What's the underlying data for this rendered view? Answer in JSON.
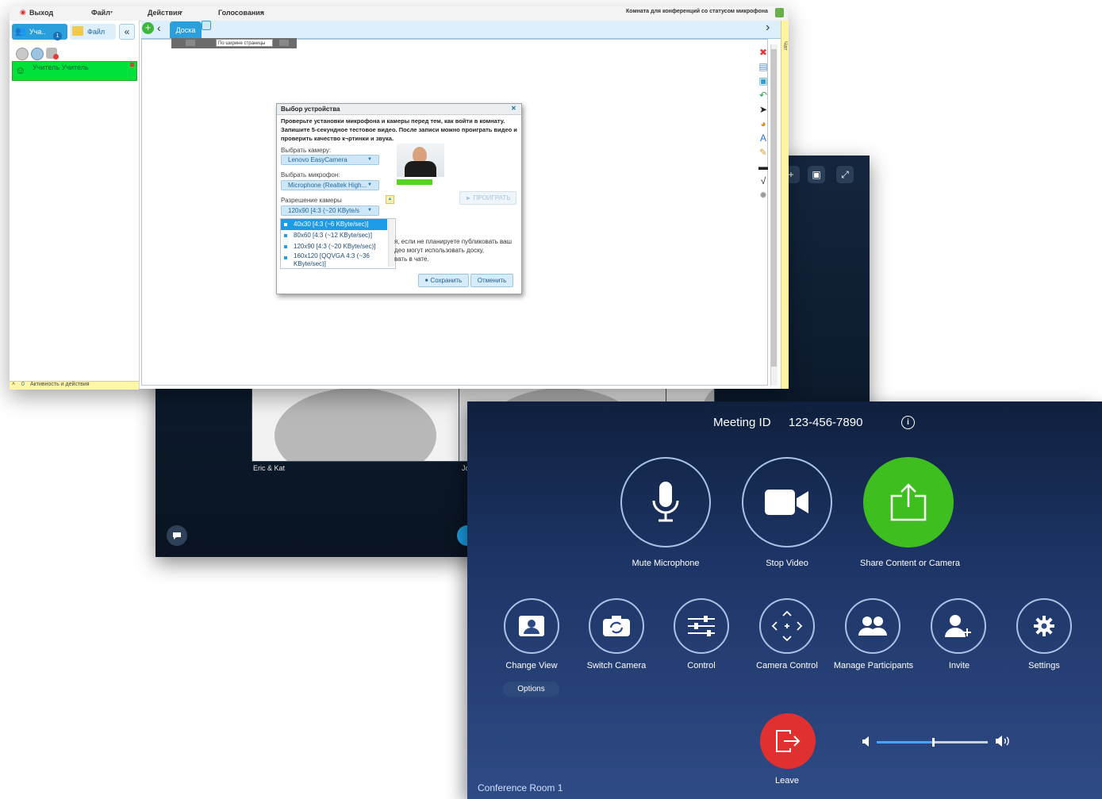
{
  "lms": {
    "menu": {
      "exit": "Выход",
      "file": "Файл",
      "actions": "Действия",
      "voting": "Голосования"
    },
    "room_status": "Комната для конференций со статусом микрофона",
    "left_tabs": {
      "participants": "Уча..",
      "files": "Файл",
      "participants_badge": "1"
    },
    "teacher_name": "Учитель Учитель",
    "footer": {
      "count": "0",
      "label": "Активность и действия"
    },
    "board_tab": "Доска",
    "zoom_select": "По ширине страницы",
    "side_tab": "Чат"
  },
  "dialog": {
    "title": "Выбор устройства",
    "intro": "Проверьте установки микрофона и камеры перед тем, как войти в комнату. Запишите 5-секундное тестовое видео. После записи можно проиграть видео и проверить качество к¬ртинки и звука.",
    "camera_label": "Выбрать камеру:",
    "camera_value": "Lenovo EasyCamera",
    "mic_label": "Выбрать микрофон:",
    "mic_value": "Microphone (Realtek High...",
    "resolution_label": "Разрешение камеры",
    "resolution_value": "120x90 [4:3 (~20 KByte/s",
    "play_button": "► ПРОИГРАТЬ",
    "options": [
      "40x30 [4:3 (~6 KByte/sec)]",
      "80x60 [4:3 (~12 KByte/sec)]",
      "120x90 [4:3 (~20 KByte/sec)]",
      "160x120 [QQVGA 4:3 (~36 KByte/sec)]"
    ],
    "hint_lines": [
      "я, если не планируете публиковать ваш",
      "део могут использовать доску,",
      "вать в чате."
    ],
    "save_button": "Сохранить",
    "cancel_button": "Отменить"
  },
  "video_window": {
    "tile_label_1": "Eric & Kat",
    "tile_label_2": "Jo"
  },
  "conference": {
    "meeting_id_label": "Meeting ID",
    "meeting_id_value": "123-456-7890",
    "main_buttons": [
      {
        "label": "Mute Microphone",
        "icon": "microphone-icon"
      },
      {
        "label": "Stop Video",
        "icon": "video-camera-icon"
      },
      {
        "label": "Share Content or Camera",
        "icon": "share-icon"
      }
    ],
    "secondary_buttons": [
      {
        "label": "Change View",
        "icon": "change-view-icon"
      },
      {
        "label": "Switch Camera",
        "icon": "switch-camera-icon"
      },
      {
        "label": "Control",
        "icon": "sliders-icon"
      },
      {
        "label": "Camera Control",
        "icon": "camera-control-icon"
      },
      {
        "label": "Manage Participants",
        "icon": "participants-icon"
      },
      {
        "label": "Invite",
        "icon": "invite-icon"
      },
      {
        "label": "Settings",
        "icon": "gear-icon"
      }
    ],
    "options_button": "Options",
    "leave_label": "Leave",
    "volume_level": 0.5,
    "room_name": "Conference Room 1",
    "colors": {
      "share": "#3fbf1f",
      "leave": "#e03030",
      "volume": "#4aa3ff"
    }
  }
}
